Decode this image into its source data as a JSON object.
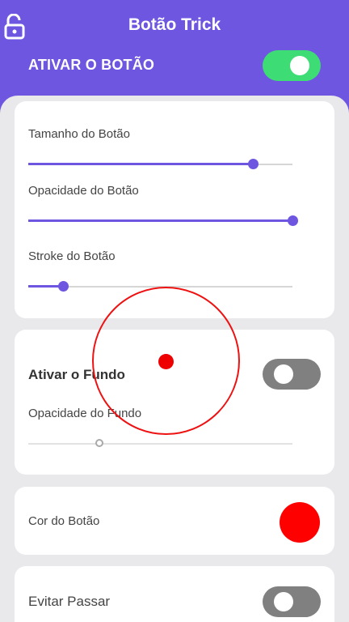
{
  "header": {
    "title": "Botão Trick",
    "activate_label": "ATIVAR O BOTÃO",
    "activate_on": true,
    "lock_icon": "unlock-icon"
  },
  "button_settings": {
    "size": {
      "label": "Tamanho do Botão",
      "value": 0.85
    },
    "opacity": {
      "label": "Opacidade do Botão",
      "value": 1.0
    },
    "stroke": {
      "label": "Stroke do Botão",
      "value": 0.13
    }
  },
  "background_settings": {
    "label": "Ativar o Fundo",
    "enabled": false,
    "opacity": {
      "label": "Opacidade do Fundo",
      "value": 0.27
    }
  },
  "color_settings": {
    "label": "Cor do Botão",
    "color": "#ff0000"
  },
  "avoid_settings": {
    "label": "Evitar Passar",
    "enabled": false
  },
  "colors": {
    "accent": "#6e56e0",
    "toggle_on": "#3ddc74",
    "toggle_off": "#808080"
  }
}
